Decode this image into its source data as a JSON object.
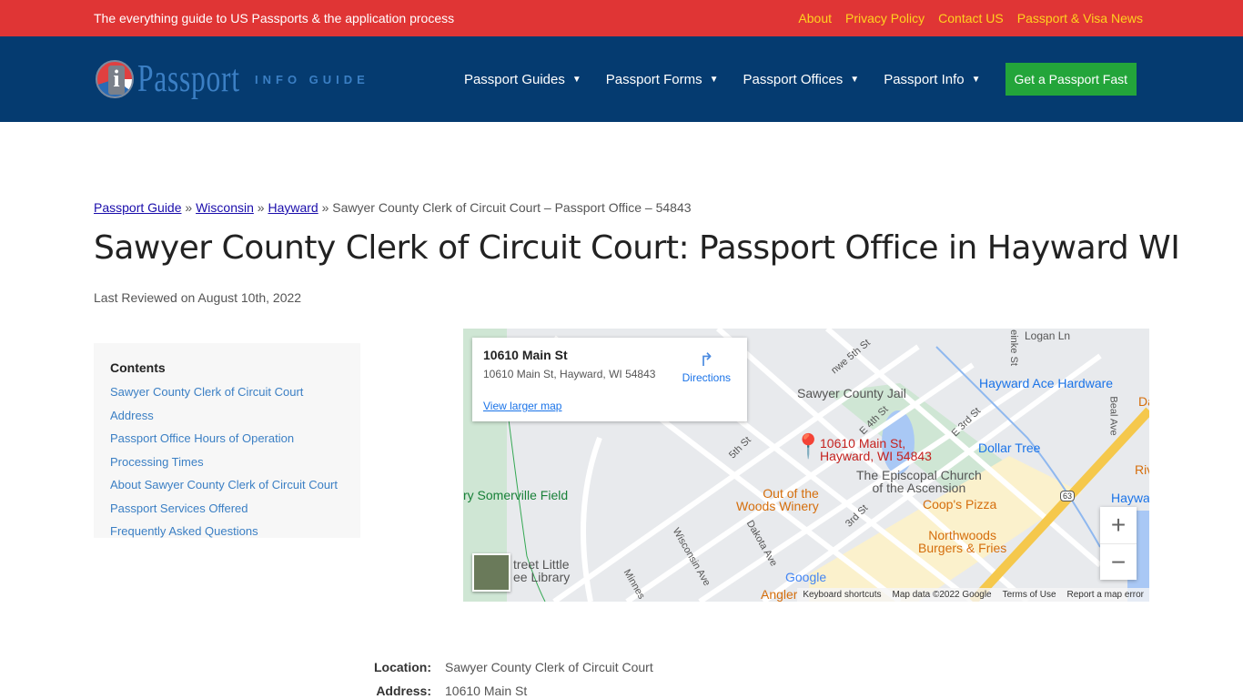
{
  "topbar": {
    "tagline": "The everything guide to US Passports & the application process",
    "links": [
      "About",
      "Privacy Policy",
      "Contact US",
      "Passport & Visa News"
    ]
  },
  "nav": {
    "logo_text": "Passport",
    "logo_sub": "INFO GUIDE",
    "items": [
      "Passport Guides",
      "Passport Forms",
      "Passport Offices",
      "Passport Info"
    ],
    "cta": "Get a Passport Fast"
  },
  "breadcrumb": {
    "items": [
      "Passport Guide",
      "Wisconsin",
      "Hayward"
    ],
    "current": "Sawyer County Clerk of Circuit Court – Passport Office – 54843",
    "sep": "»"
  },
  "title": "Sawyer County Clerk of Circuit Court: Passport Office in Hayward WI",
  "reviewed": "Last Reviewed on August 10th, 2022",
  "toc": {
    "heading": "Contents",
    "items": [
      "Sawyer County Clerk of Circuit Court Address",
      "Passport Office Hours of Operation",
      "Processing Times",
      "About Sawyer County Clerk of Circuit Court",
      "Passport Services Offered",
      "Frequently Asked Questions"
    ]
  },
  "map": {
    "card_title": "10610 Main St",
    "card_address": "10610 Main St, Hayward, WI 54843",
    "directions": "Directions",
    "larger": "View larger map",
    "pin_label_1": "10610 Main St,",
    "pin_label_2": "Hayward, WI 54843",
    "places": [
      "Sawyer County Jail",
      "Hayward Ace Hardware",
      "Dollar Tree",
      "The Episcopal Church",
      "of the Ascension",
      "Coop's Pizza",
      "Northwoods",
      "Burgers & Fries",
      "Out of the",
      "Woods Winery",
      "ry Somerville Field",
      "treet Little",
      "ee Library",
      "Logan Ln",
      "Dair",
      "Riv",
      "Haywa",
      "Angler"
    ],
    "streets": [
      "5th St",
      "nwe 5th St",
      "E 4th St",
      "E 3rd St",
      "3rd St",
      "Dakota Ave",
      "Wisconsin Ave",
      "Minnes",
      "Beal Ave",
      "einke St",
      "63"
    ],
    "footer": [
      "Keyboard shortcuts",
      "Map data ©2022 Google",
      "Terms of Use",
      "Report a map error"
    ],
    "google": "Google",
    "zoom_in": "+",
    "zoom_out": "−"
  },
  "details": [
    {
      "k": "Location:",
      "v": "Sawyer County Clerk of Circuit Court"
    },
    {
      "k": "Address:",
      "v": "10610 Main St"
    }
  ]
}
